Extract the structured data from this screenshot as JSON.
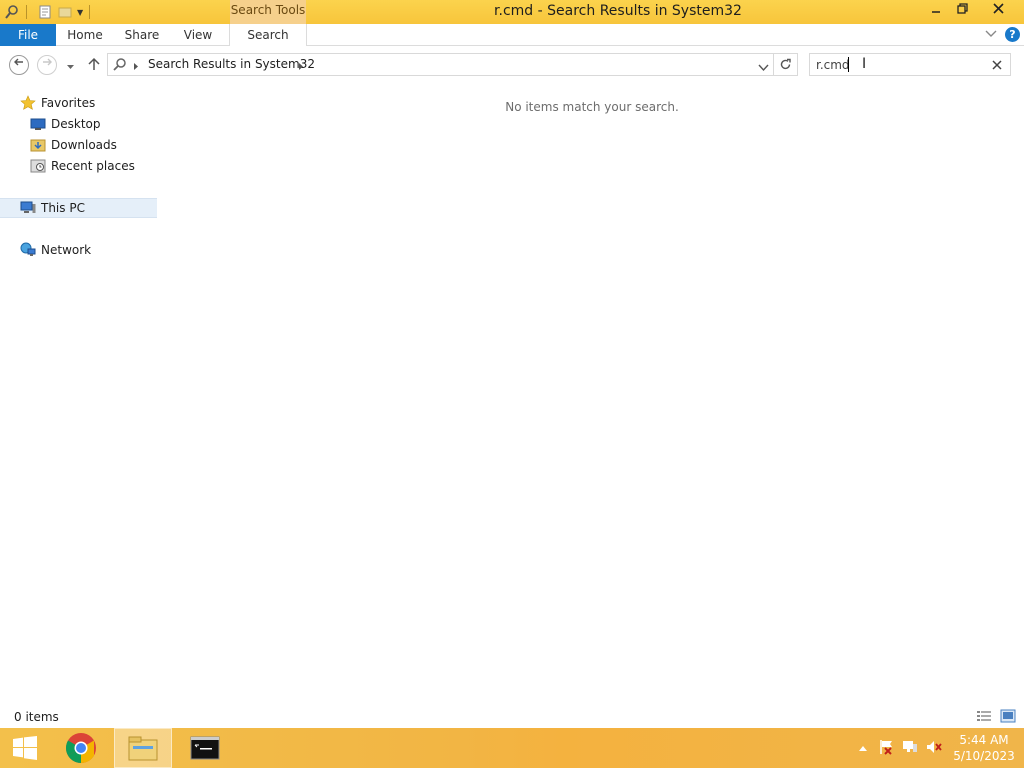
{
  "window": {
    "title": "r.cmd - Search Results in System32",
    "context_tab": "Search Tools"
  },
  "ribbon": {
    "tabs": [
      "File",
      "Home",
      "Share",
      "View",
      "Search"
    ]
  },
  "address": {
    "breadcrumb": "Search Results in System32"
  },
  "search": {
    "value": "r.cmd"
  },
  "nav": {
    "favorites": "Favorites",
    "desktop": "Desktop",
    "downloads": "Downloads",
    "recent": "Recent places",
    "this_pc": "This PC",
    "network": "Network"
  },
  "content": {
    "empty_message": "No items match your search."
  },
  "status": {
    "item_count": "0 items"
  },
  "taskbar": {
    "time": "5:44 AM",
    "date": "5/10/2023"
  },
  "colors": {
    "accent": "#1979ca",
    "title_bar": "#f7c53b",
    "taskbar": "#f2b544"
  }
}
